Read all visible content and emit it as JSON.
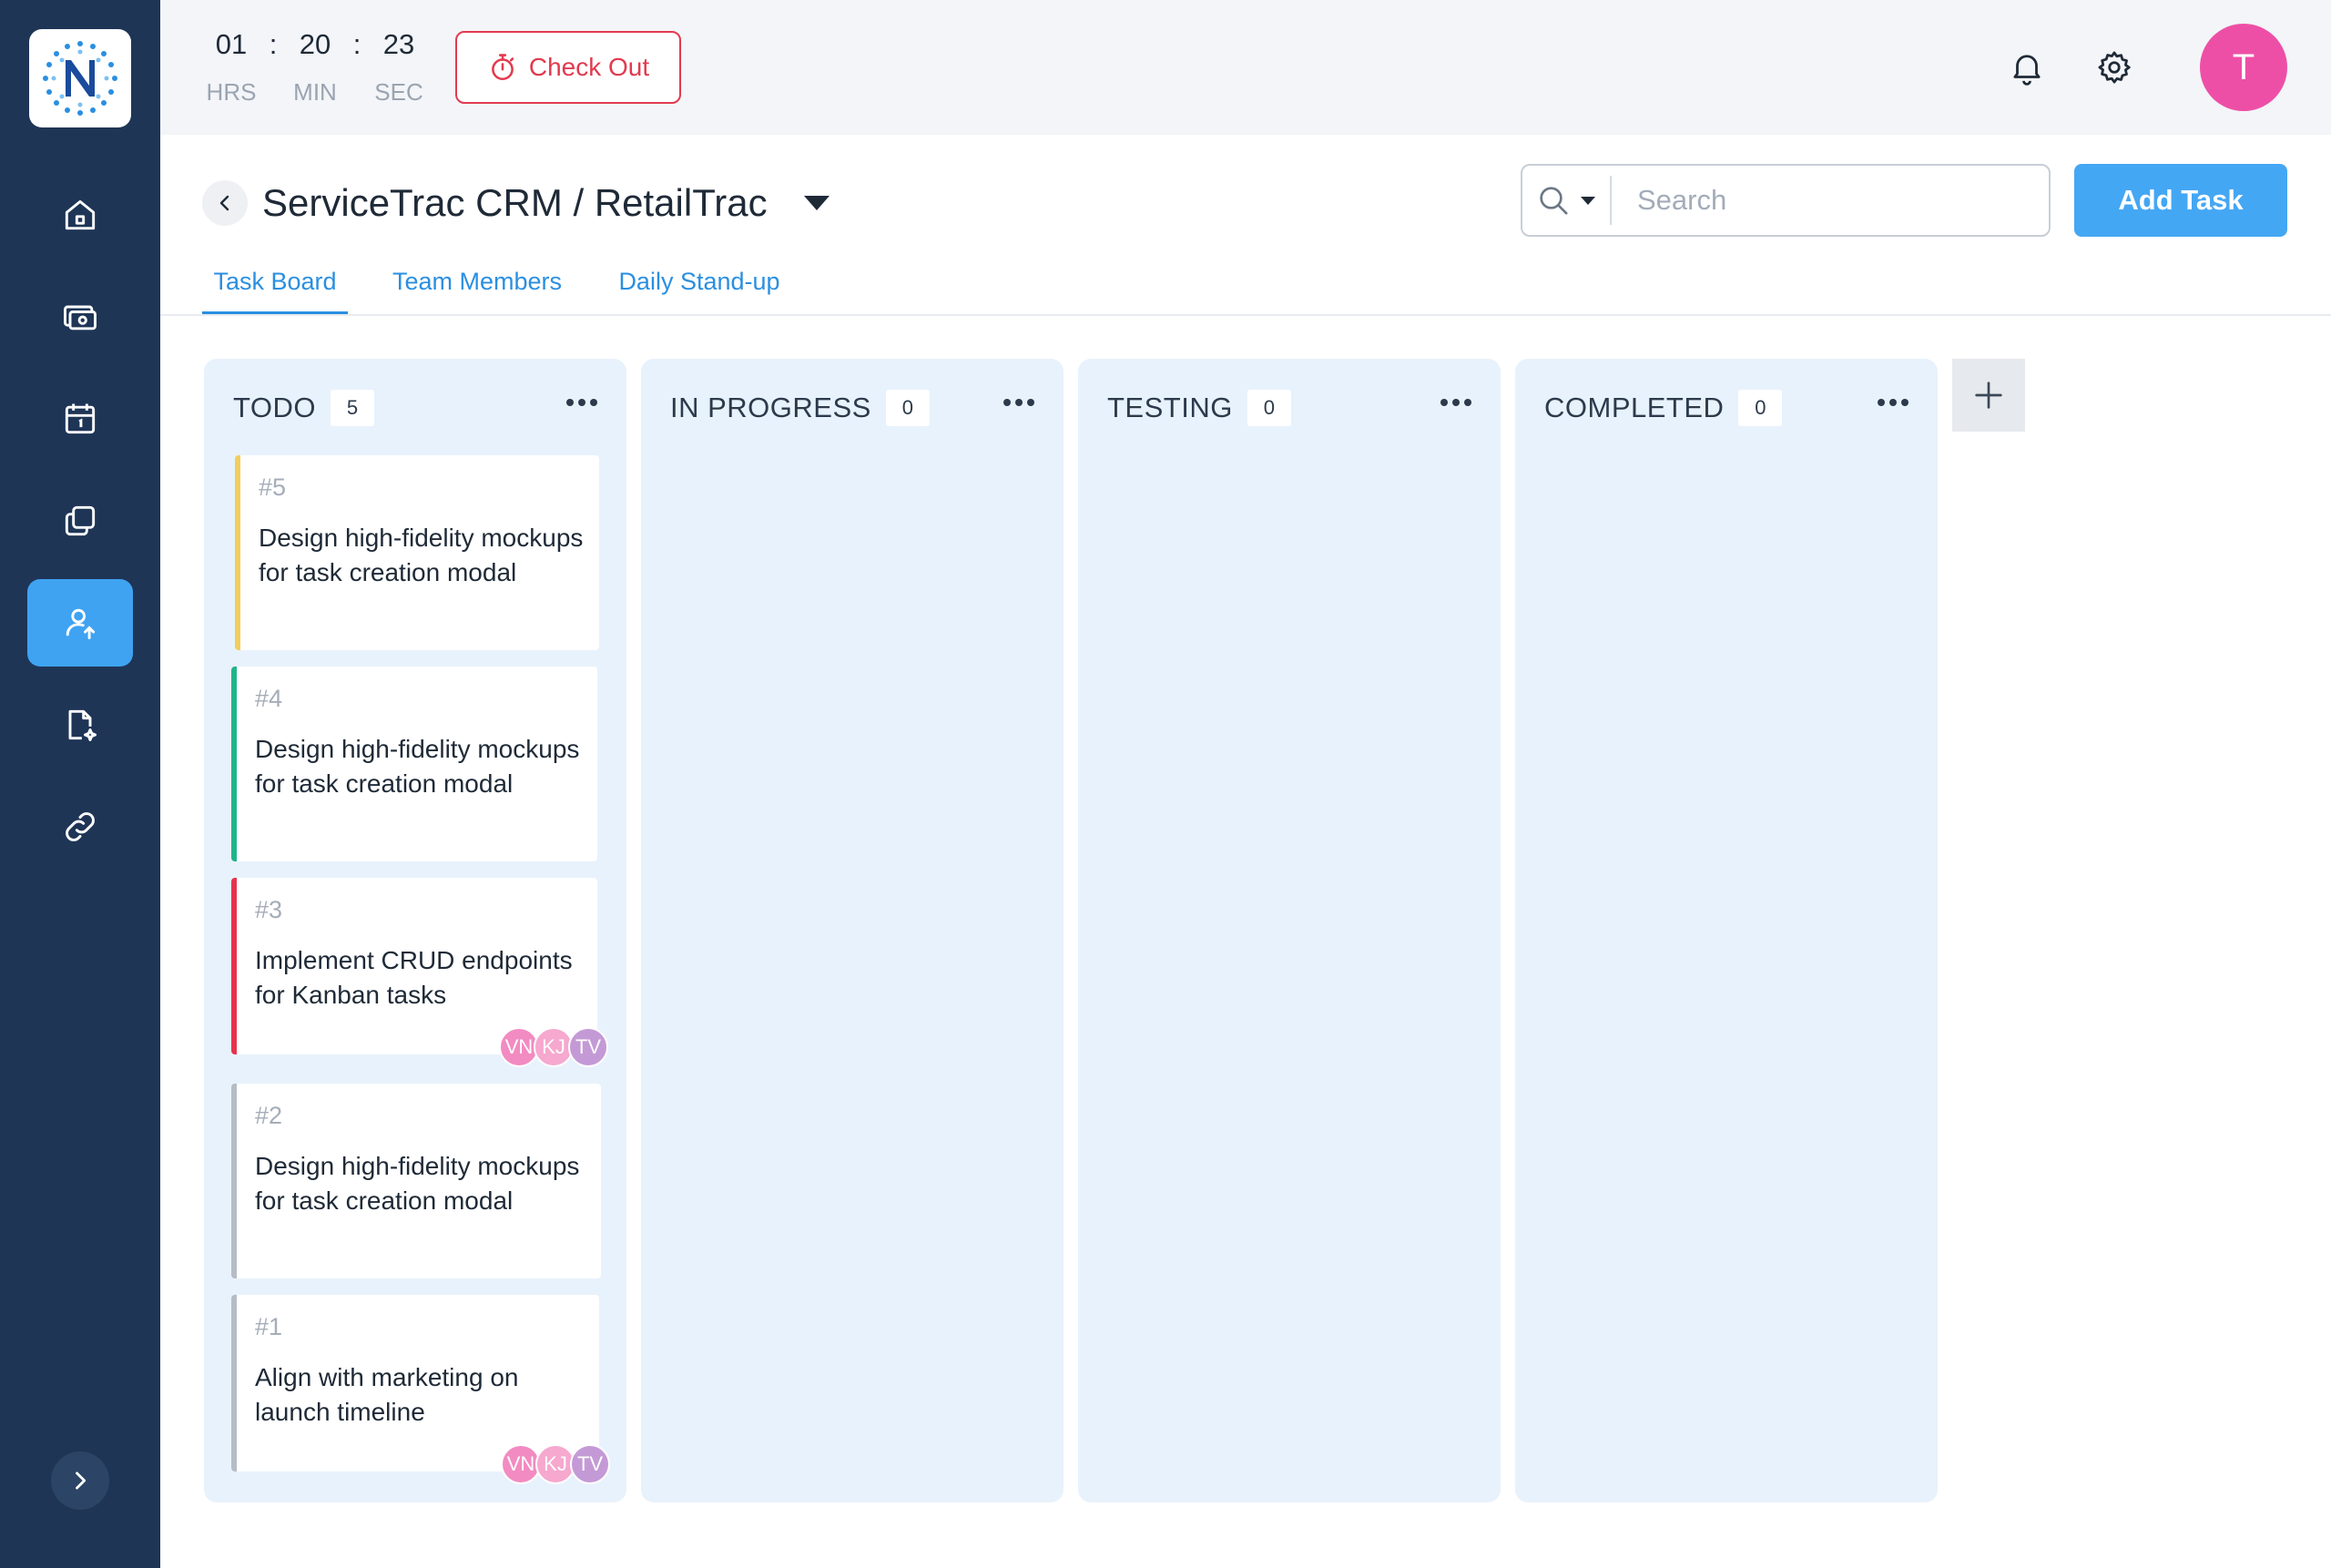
{
  "timer": {
    "hours": "01",
    "minutes": "20",
    "seconds": "23",
    "hours_label": "HRS",
    "minutes_label": "MIN",
    "seconds_label": "SEC",
    "separator": ":"
  },
  "topbar": {
    "checkout_label": "Check Out",
    "avatar_initial": "T",
    "avatar_color": "#ee4fa6"
  },
  "header": {
    "project_title": "ServiceTrac CRM / RetailTrac",
    "search_placeholder": "Search",
    "add_task_label": "Add Task"
  },
  "tabs": [
    {
      "label": "Task Board",
      "active": true
    },
    {
      "label": "Team Members",
      "active": false
    },
    {
      "label": "Daily Stand-up",
      "active": false
    }
  ],
  "sidebar": {
    "items": [
      {
        "icon": "home-icon"
      },
      {
        "icon": "money-icon"
      },
      {
        "icon": "calendar-icon"
      },
      {
        "icon": "copy-icon"
      },
      {
        "icon": "user-upload-icon",
        "active": true
      },
      {
        "icon": "file-sparkle-icon"
      },
      {
        "icon": "link-icon"
      }
    ]
  },
  "columns": [
    {
      "title": "TODO",
      "count": "5"
    },
    {
      "title": "IN PROGRESS",
      "count": "0"
    },
    {
      "title": "TESTING",
      "count": "0"
    },
    {
      "title": "COMPLETED",
      "count": "0"
    }
  ],
  "cards": [
    {
      "id": "#5",
      "title": "Design high-fidelity mockups for task creation modal",
      "accent": "#f2cf5b",
      "assignees": []
    },
    {
      "id": "#4",
      "title": "Design high-fidelity mockups for task creation modal",
      "accent": "#1fb58a",
      "assignees": []
    },
    {
      "id": "#3",
      "title": "Implement CRUD endpoints for Kanban tasks",
      "accent": "#e6334f",
      "assignees": [
        "VN",
        "KJ",
        "TV"
      ]
    },
    {
      "id": "#2",
      "title": "Design high-fidelity mockups for task creation modal",
      "accent": "#b6bcc6",
      "assignees": []
    },
    {
      "id": "#1",
      "title": "Align with marketing on launch timeline",
      "accent": "#b6bcc6",
      "assignees": [
        "VN",
        "KJ",
        "TV"
      ]
    }
  ],
  "colors": {
    "sidebar_bg": "#1e3556",
    "accent_blue": "#44a7f4",
    "danger": "#e23a4f",
    "column_bg": "#e8f2fc",
    "assignee_vn": "#f28bc1",
    "assignee_kj": "#f6a8cf",
    "assignee_tv": "#c49ad6"
  }
}
